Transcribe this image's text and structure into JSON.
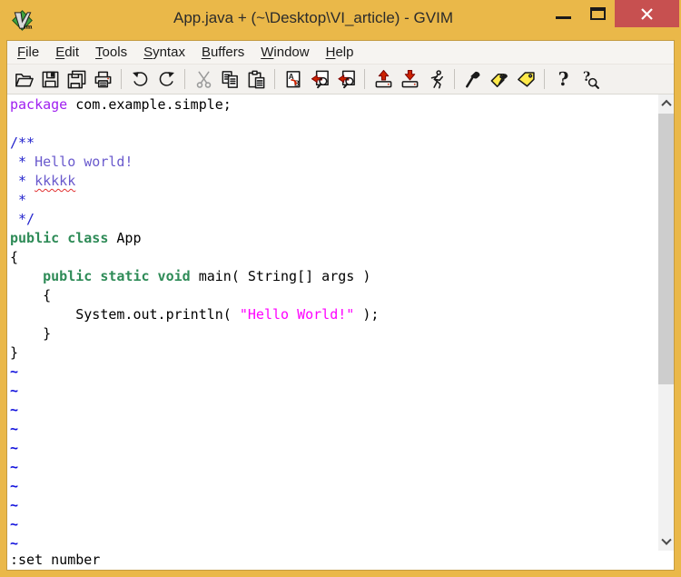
{
  "window": {
    "title": "App.java + (~\\Desktop\\VI_article) - GVIM"
  },
  "menu": {
    "items": [
      {
        "label": "File",
        "access_key_index": 0
      },
      {
        "label": "Edit",
        "access_key_index": 0
      },
      {
        "label": "Tools",
        "access_key_index": 0
      },
      {
        "label": "Syntax",
        "access_key_index": 0
      },
      {
        "label": "Buffers",
        "access_key_index": 0
      },
      {
        "label": "Window",
        "access_key_index": 0
      },
      {
        "label": "Help",
        "access_key_index": 0
      }
    ]
  },
  "toolbar": {
    "items": [
      {
        "icon": "open-file-icon"
      },
      {
        "icon": "save-file-icon"
      },
      {
        "icon": "save-all-icon"
      },
      {
        "icon": "print-icon"
      },
      {
        "separator": true
      },
      {
        "icon": "undo-icon"
      },
      {
        "icon": "redo-icon"
      },
      {
        "separator": true
      },
      {
        "icon": "cut-icon",
        "disabled": true
      },
      {
        "icon": "copy-icon"
      },
      {
        "icon": "paste-icon"
      },
      {
        "separator": true
      },
      {
        "icon": "find-replace-icon"
      },
      {
        "icon": "find-next-icon"
      },
      {
        "icon": "find-prev-icon"
      },
      {
        "separator": true
      },
      {
        "icon": "load-session-icon"
      },
      {
        "icon": "save-session-icon"
      },
      {
        "icon": "run-script-icon"
      },
      {
        "separator": true
      },
      {
        "icon": "make-icon"
      },
      {
        "icon": "build-tags-icon"
      },
      {
        "icon": "tag-jump-icon"
      },
      {
        "separator": true
      },
      {
        "icon": "help-icon"
      },
      {
        "icon": "find-help-icon"
      }
    ]
  },
  "editor": {
    "lines": [
      {
        "tokens": [
          {
            "t": "package",
            "c": "preproc"
          },
          {
            "t": " com.example.simple;",
            "c": "plain"
          }
        ]
      },
      {
        "tokens": []
      },
      {
        "tokens": [
          {
            "t": "/**",
            "c": "comment"
          }
        ]
      },
      {
        "tokens": [
          {
            "t": " * ",
            "c": "comment"
          },
          {
            "t": "Hello world!",
            "c": "special"
          }
        ]
      },
      {
        "tokens": [
          {
            "t": " * ",
            "c": "comment"
          },
          {
            "t": "kkkkk",
            "c": "special",
            "spell": true
          }
        ]
      },
      {
        "tokens": [
          {
            "t": " *",
            "c": "comment"
          }
        ]
      },
      {
        "tokens": [
          {
            "t": " */",
            "c": "comment"
          }
        ]
      },
      {
        "tokens": [
          {
            "t": "public class",
            "c": "type"
          },
          {
            "t": " App",
            "c": "plain"
          }
        ]
      },
      {
        "tokens": [
          {
            "t": "{",
            "c": "plain"
          }
        ]
      },
      {
        "tokens": [
          {
            "t": "    ",
            "c": "plain"
          },
          {
            "t": "public static void",
            "c": "type"
          },
          {
            "t": " main( String[] args )",
            "c": "plain"
          }
        ]
      },
      {
        "tokens": [
          {
            "t": "    {",
            "c": "plain"
          }
        ]
      },
      {
        "tokens": [
          {
            "t": "        System.out.println( ",
            "c": "plain"
          },
          {
            "t": "\"Hello World!\"",
            "c": "string"
          },
          {
            "t": " );",
            "c": "plain"
          }
        ]
      },
      {
        "tokens": [
          {
            "t": "    }",
            "c": "plain"
          }
        ]
      },
      {
        "tokens": [
          {
            "t": "}",
            "c": "plain"
          }
        ]
      }
    ],
    "filler_char": "~",
    "filler_count": 10
  },
  "command_line": {
    "text": ":set number"
  },
  "colors": {
    "titlebar": "#eab849",
    "close_button": "#c75050",
    "keyword": "#2e8b57",
    "preproc": "#a020f0",
    "comment": "#2323cd",
    "comment_title": "#6a5acd",
    "string": "#ff00ff",
    "nontext_tilde": "#1111dd",
    "spell_underline": "#e23131"
  }
}
